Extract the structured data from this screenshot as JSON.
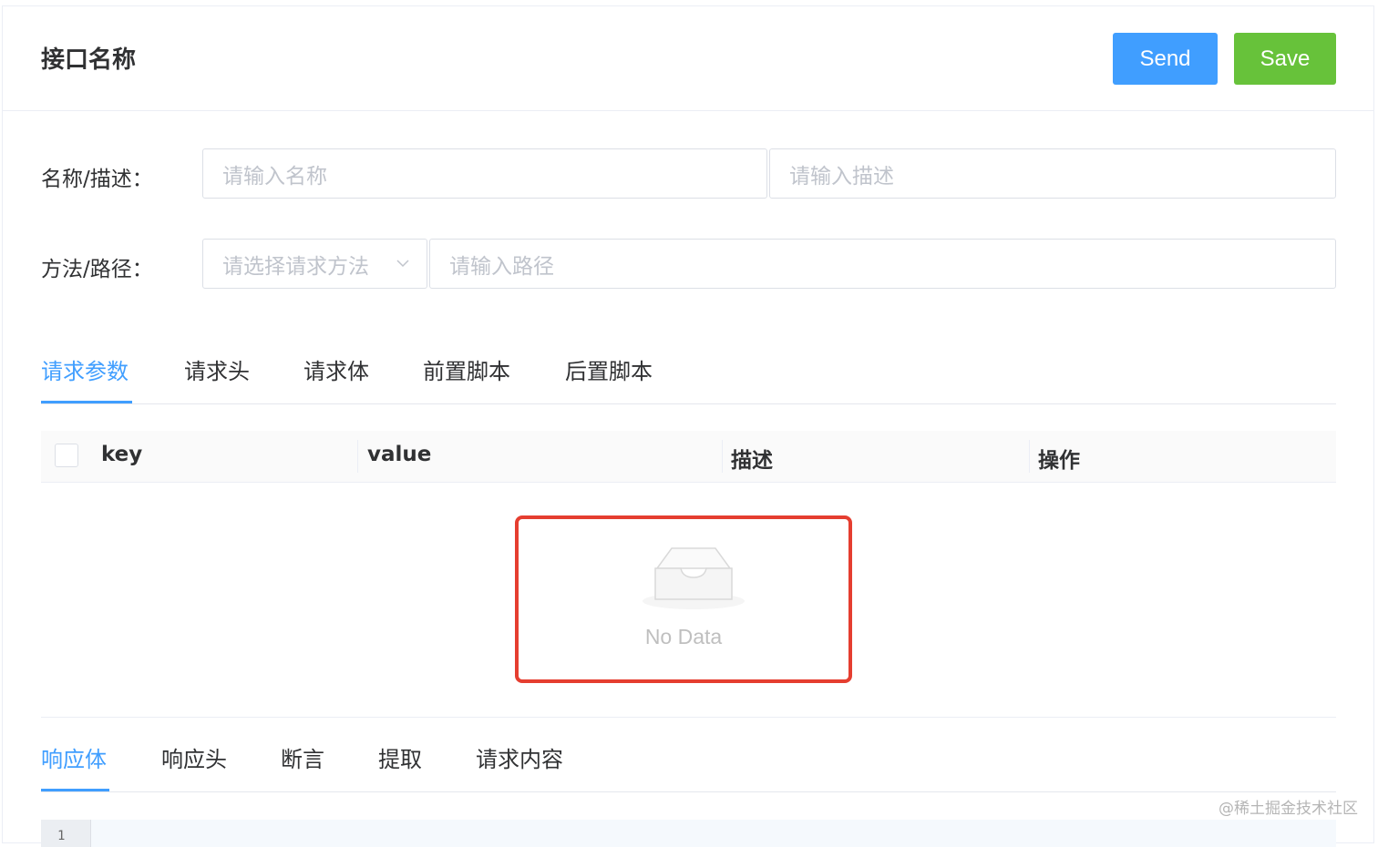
{
  "header": {
    "title": "接口名称",
    "send_label": "Send",
    "save_label": "Save"
  },
  "form": {
    "name_desc_label": "名称/描述：",
    "name_placeholder": "请输入名称",
    "desc_placeholder": "请输入描述",
    "method_path_label": "方法/路径：",
    "method_placeholder": "请选择请求方法",
    "path_placeholder": "请输入路径"
  },
  "request_tabs": [
    {
      "label": "请求参数",
      "active": true
    },
    {
      "label": "请求头",
      "active": false
    },
    {
      "label": "请求体",
      "active": false
    },
    {
      "label": "前置脚本",
      "active": false
    },
    {
      "label": "后置脚本",
      "active": false
    }
  ],
  "params_table": {
    "columns": [
      "key",
      "value",
      "描述",
      "操作"
    ],
    "rows": [],
    "empty_text": "No Data"
  },
  "response_tabs": [
    {
      "label": "响应体",
      "active": true
    },
    {
      "label": "响应头",
      "active": false
    },
    {
      "label": "断言",
      "active": false
    },
    {
      "label": "提取",
      "active": false
    },
    {
      "label": "请求内容",
      "active": false
    }
  ],
  "editor": {
    "line_number": "1"
  },
  "watermark": "@稀土掘金技术社区",
  "colors": {
    "primary": "#409eff",
    "success": "#67c23a",
    "highlight_border": "#e53e30"
  }
}
